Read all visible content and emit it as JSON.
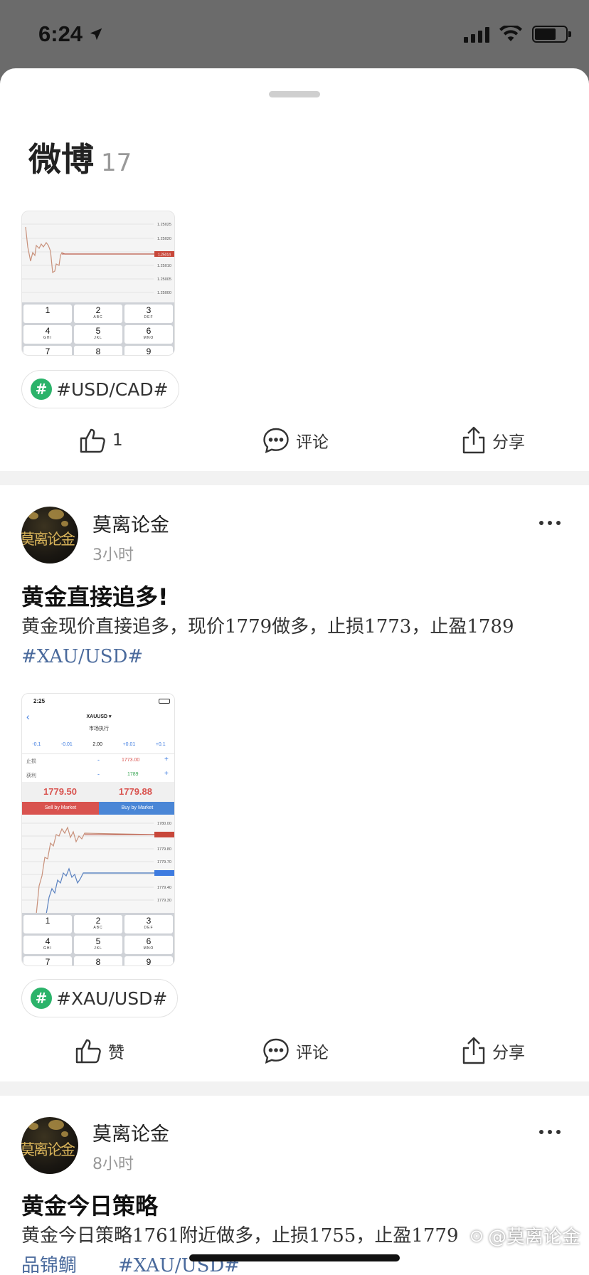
{
  "status": {
    "time": "6:24"
  },
  "sheet": {
    "title": "微博",
    "count": "17"
  },
  "thumb1": {
    "prices": [
      "1.25025",
      "1.25020",
      "1.25015",
      "1.25010",
      "1.25005",
      "1.25000"
    ],
    "tag_price": "1.25014",
    "keys": [
      [
        "1",
        ""
      ],
      [
        "2",
        "ABC"
      ],
      [
        "3",
        "DEF"
      ],
      [
        "4",
        "GHI"
      ],
      [
        "5",
        "JKL"
      ],
      [
        "6",
        "MNO"
      ],
      [
        "7",
        ""
      ],
      [
        "8",
        ""
      ],
      [
        "9",
        ""
      ]
    ]
  },
  "post0": {
    "topic": "#USD/CAD#",
    "like": "1",
    "comment": "评论",
    "share": "分享"
  },
  "post1": {
    "author": "莫离论金",
    "time": "3小时",
    "title": "黄金直接追多!",
    "body": "黄金现价直接追多，现价1779做多，止损1773，止盈1789",
    "body_tag": "#XAU/USD#",
    "topic": "#XAU/USD#",
    "like": "赞",
    "comment": "评论",
    "share": "分享"
  },
  "thumb2": {
    "time": "2:25",
    "symbol": "XAUUSD ▾",
    "mode": "市场执行",
    "steps": [
      "-0.1",
      "-0.01",
      "2.00",
      "+0.01",
      "+0.1"
    ],
    "sl_label": "止损",
    "sl_value": "1773.00",
    "tp_label": "获利",
    "tp_value": "1789",
    "sell_big": "1779.50",
    "buy_big": "1779.88",
    "sell_btn": "Sell by Market",
    "buy_btn": "Buy by Market",
    "prices": [
      "1780.00",
      "1779.90",
      "1779.80",
      "1779.70",
      "1779.60",
      "1779.50",
      "1779.40",
      "1779.30"
    ],
    "keys": [
      [
        "1",
        ""
      ],
      [
        "2",
        "ABC"
      ],
      [
        "3",
        "DEF"
      ],
      [
        "4",
        "GHI"
      ],
      [
        "5",
        "JKL"
      ],
      [
        "6",
        "MNO"
      ],
      [
        "7",
        ""
      ],
      [
        "8",
        ""
      ],
      [
        "9",
        ""
      ]
    ]
  },
  "post2": {
    "author": "莫离论金",
    "time": "8小时",
    "title": "黄金今日策略",
    "body": "黄金今日策略1761附近做多，止损1755，止盈1779",
    "body_tail": "品锦鲷",
    "body_tag": "#XAU/USD#"
  },
  "watermark": "@莫离论金",
  "colors": {
    "accent_green": "#2bb36a",
    "tag_blue": "#4a6a9c",
    "sell_red": "#d9534f",
    "buy_blue": "#4a86d6"
  }
}
